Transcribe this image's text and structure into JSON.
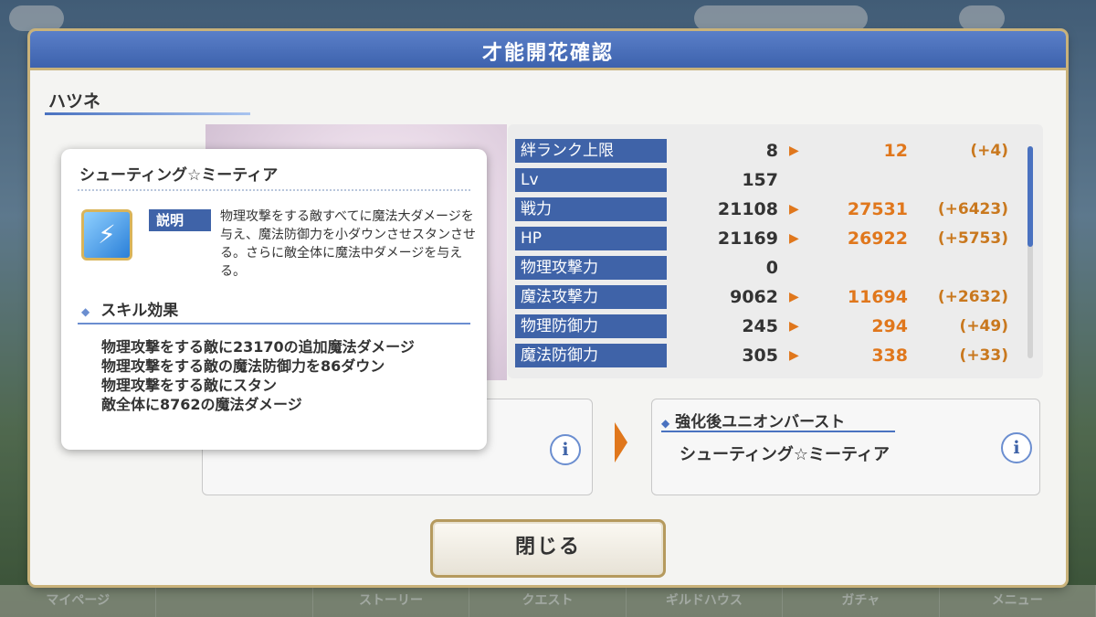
{
  "dialog": {
    "title": "才能開花確認",
    "character_name": "ハツネ",
    "close_label": "閉じる"
  },
  "stats": [
    {
      "label": "絆ランク上限",
      "current": "8",
      "new": "12",
      "diff": "(+4)"
    },
    {
      "label": "Lv",
      "current": "157",
      "new": "",
      "diff": ""
    },
    {
      "label": "戦力",
      "current": "21108",
      "new": "27531",
      "diff": "(+6423)"
    },
    {
      "label": "HP",
      "current": "21169",
      "new": "26922",
      "diff": "(+5753)"
    },
    {
      "label": "物理攻撃力",
      "current": "0",
      "new": "",
      "diff": ""
    },
    {
      "label": "魔法攻撃力",
      "current": "9062",
      "new": "11694",
      "diff": "(+2632)"
    },
    {
      "label": "物理防御力",
      "current": "245",
      "new": "294",
      "diff": "(+49)"
    },
    {
      "label": "魔法防御力",
      "current": "305",
      "new": "338",
      "diff": "(+33)"
    }
  ],
  "union_burst_after": {
    "heading": "強化後ユニオンバースト",
    "skill_name": "シューティング☆ミーティア"
  },
  "popup": {
    "title": "シューティング☆ミーティア",
    "description_badge": "説明",
    "description": "物理攻撃をする敵すべてに魔法大ダメージを与え、魔法防御力を小ダウンさせスタンさせる。さらに敵全体に魔法中ダメージを与える。",
    "effects_heading": "スキル効果",
    "effects": [
      "物理攻撃をする敵に23170の追加魔法ダメージ",
      "物理攻撃をする敵の魔法防御力を86ダウン",
      "物理攻撃をする敵にスタン",
      "敵全体に8762の魔法ダメージ"
    ]
  },
  "bottom_nav": [
    "マイページ",
    "",
    "ストーリー",
    "クエスト",
    "ギルドハウス",
    "ガチャ",
    "メニュー"
  ],
  "colors": {
    "header_blue": "#3f63a8",
    "accent_orange": "#e0771c",
    "frame_gold": "#c9b27a"
  }
}
